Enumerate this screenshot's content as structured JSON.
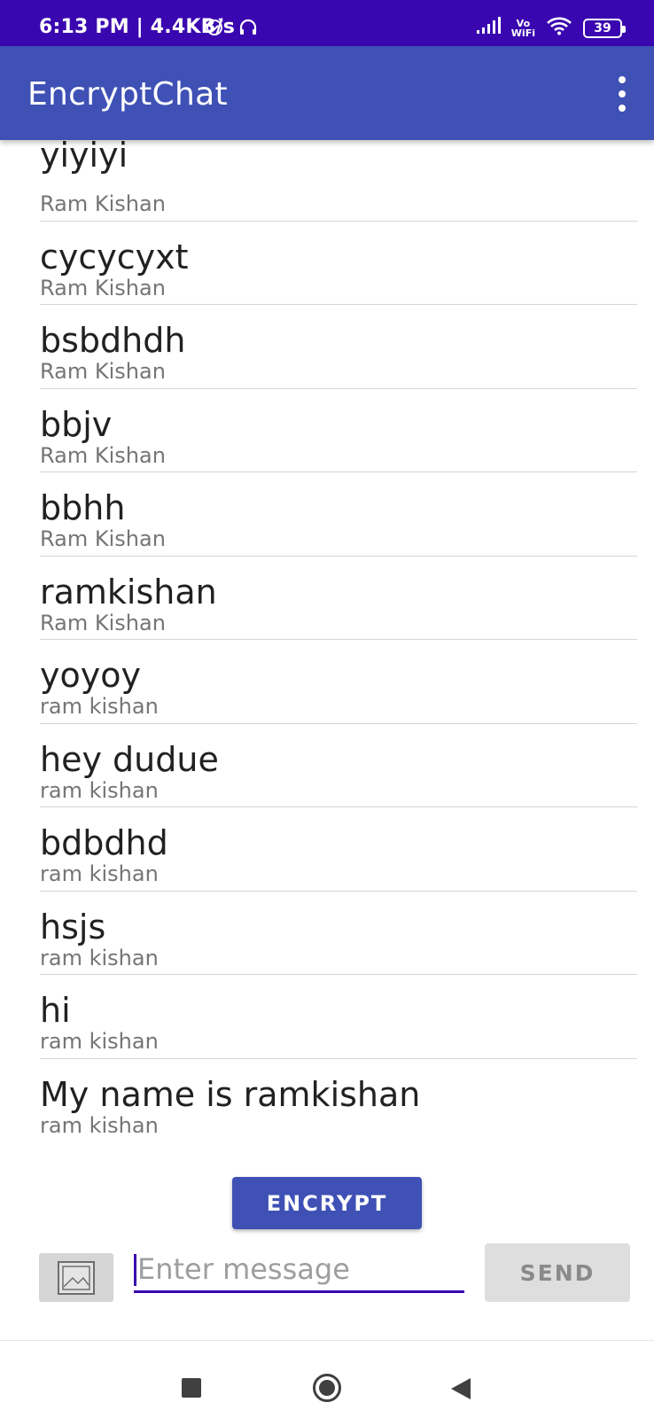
{
  "status_bar": {
    "time": "6:13 PM | 4.4KB/s",
    "vowifi_top": "Vo",
    "vowifi_bottom": "WiFi",
    "battery": "39"
  },
  "app_bar": {
    "title": "EncryptChat",
    "menu_icon": "more-vert-icon"
  },
  "messages": [
    {
      "text": "yiyiyi",
      "author": "Ram Kishan"
    },
    {
      "text": "cycycyxt",
      "author": "Ram Kishan"
    },
    {
      "text": "bsbdhdh",
      "author": "Ram Kishan"
    },
    {
      "text": "bbjv",
      "author": "Ram Kishan"
    },
    {
      "text": "bbhh",
      "author": "Ram Kishan"
    },
    {
      "text": "ramkishan",
      "author": "Ram Kishan"
    },
    {
      "text": "yoyoy",
      "author": "ram kishan"
    },
    {
      "text": "hey dudue",
      "author": "ram kishan"
    },
    {
      "text": "bdbdhd",
      "author": "ram kishan"
    },
    {
      "text": "hsjs",
      "author": "ram kishan"
    },
    {
      "text": "hi",
      "author": "ram kishan"
    },
    {
      "text": "My name is ramkishan",
      "author": "ram kishan"
    }
  ],
  "composer": {
    "encrypt_label": "ENCRYPT",
    "image_icon": "image-icon",
    "input_value": "",
    "input_placeholder": "Enter message",
    "send_label": "SEND"
  },
  "colors": {
    "status_bar": "#3a06b0",
    "app_bar": "#3f51b5",
    "accent": "#3a06b0"
  }
}
